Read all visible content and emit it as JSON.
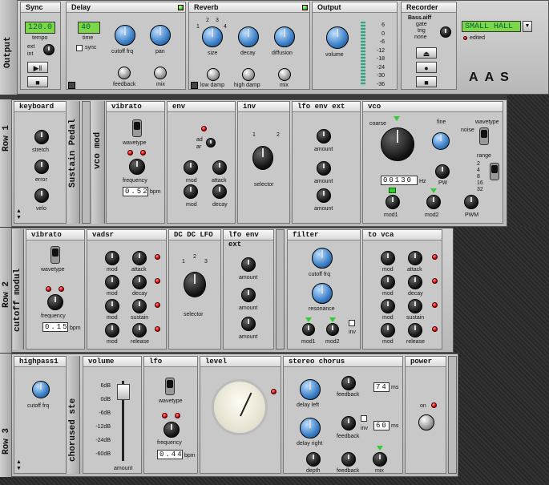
{
  "topbar": {
    "title": "Output",
    "sync": {
      "title": "Sync",
      "lcd": "120.0",
      "tempo": "tempo",
      "ext": "ext",
      "int": "int"
    },
    "delay": {
      "title": "Delay",
      "lcd": "40",
      "time": "time",
      "sync": "sync",
      "cutoff": "cutoff frq",
      "pan": "pan",
      "feedback": "feedback",
      "mix": "mix"
    },
    "reverb": {
      "title": "Reverb",
      "n1": "1",
      "n2": "2",
      "n3": "3",
      "n4": "4",
      "size": "size",
      "decay": "decay",
      "diffusion": "diffusion",
      "low_damp": "low damp",
      "high_damp": "high damp",
      "mix": "mix"
    },
    "output": {
      "title": "Output",
      "volume": "volume",
      "meter": [
        "6",
        "0",
        "-6",
        "-12",
        "-18",
        "-24",
        "-30",
        "-36"
      ]
    },
    "recorder": {
      "title": "Recorder",
      "file": "Bass.aiff",
      "gate": "gate",
      "trig": "trig",
      "none": "none",
      "preset": "SMALL HALL",
      "edited": "edited",
      "logo": [
        "A",
        "A",
        "S"
      ]
    }
  },
  "row1": {
    "label": "Row 1",
    "sustain": "Sustain Pedal",
    "vcomod": "vco mod",
    "keyboard": {
      "title": "keyboard",
      "stretch": "stretch",
      "error": "error",
      "velo": "velo"
    },
    "vibrato": {
      "title": "vibrato",
      "wavetype": "wavetype",
      "frequency": "frequency",
      "digits": "0.52",
      "bpm": "bpm"
    },
    "env": {
      "title": "env",
      "ad": "ad",
      "ar": "ar",
      "mod1": "mod",
      "attack": "attack",
      "mod2": "mod",
      "decay": "decay"
    },
    "inv": {
      "title": "inv",
      "n1": "1",
      "n2": "2",
      "selector": "selector"
    },
    "lfoenv": {
      "title": "lfo env ext",
      "a1": "amount",
      "a2": "amount",
      "a3": "amount"
    },
    "vco": {
      "title": "vco",
      "coarse": "coarse",
      "fine": "fine",
      "wavetype": "wavetype",
      "noise": "noise",
      "digits": "00130",
      "hz": "Hz",
      "pw": "PW",
      "range": "range",
      "ranges": [
        "2",
        "4",
        "8",
        "16",
        "32"
      ],
      "mod1": "mod1",
      "mod2": "mod2",
      "pwm": "PWM"
    }
  },
  "row2": {
    "label": "Row 2",
    "cutoff": "cutoff modul",
    "vibrato": {
      "title": "vibrato",
      "wavetype": "wavetype",
      "frequency": "frequency",
      "digits": "0.15",
      "bpm": "bpm"
    },
    "vadsr": {
      "title": "vadsr",
      "mod": "mod",
      "attack": "attack",
      "decay": "decay",
      "sustain": "sustain",
      "release": "release"
    },
    "dc": {
      "title": "DC DC LFO",
      "n1": "1",
      "n2": "2",
      "n3": "3",
      "selector": "selector"
    },
    "lfoenv": {
      "title": "lfo env ext",
      "a1": "amount",
      "a2": "amount",
      "a3": "amount"
    },
    "filter": {
      "title": "filter",
      "cutoff": "cutoff frq",
      "resonance": "resonance",
      "mod1": "mod1",
      "mod2": "mod2",
      "inv": "inv"
    },
    "tovca": {
      "title": "to vca",
      "mod": "mod",
      "attack": "attack",
      "decay": "decay",
      "sustain": "sustain",
      "release": "release"
    }
  },
  "row3": {
    "label": "Row 3",
    "chorused": "chorused ste",
    "highpass": {
      "title": "highpass1",
      "cutoff": "cutoff frq"
    },
    "volume": {
      "title": "volume",
      "scale": [
        "6dB",
        "0dB",
        "-6dB",
        "-12dB",
        "-24dB",
        "-60dB"
      ],
      "amount": "amount"
    },
    "lfo": {
      "title": "lfo",
      "wavetype": "wavetype",
      "frequency": "frequency",
      "digits": "0.44",
      "bpm": "bpm"
    },
    "level": {
      "title": "level"
    },
    "chorus": {
      "title": "stereo chorus",
      "delay_left": "delay left",
      "feedback1": "feedback",
      "ms1": "74",
      "ms": "ms",
      "delay_right": "delay right",
      "feedback2": "feedback",
      "inv": "inv",
      "ms2": "60",
      "depth": "depth",
      "feedback3": "feedback",
      "mix": "mix"
    },
    "power": {
      "title": "power",
      "on": "on"
    }
  }
}
